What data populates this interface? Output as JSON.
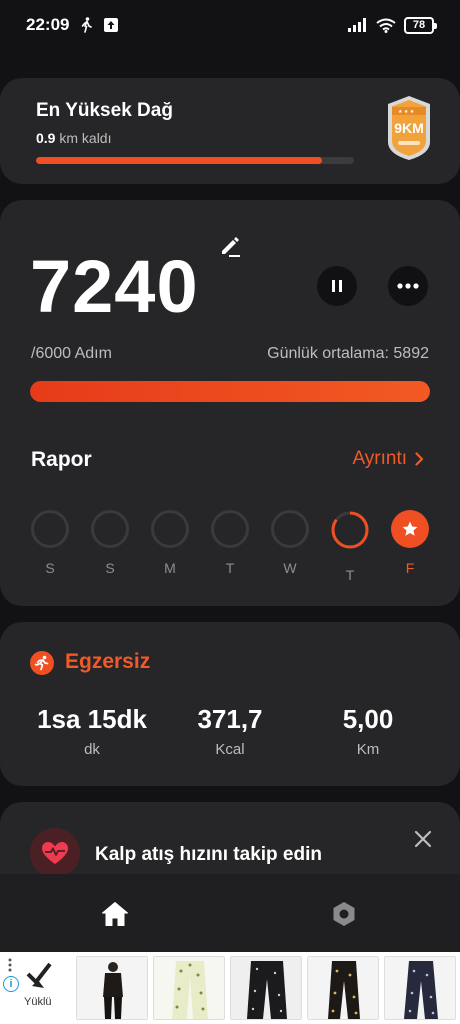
{
  "status_bar": {
    "time": "22:09",
    "battery": "78"
  },
  "challenge": {
    "title": "En Yüksek Dağ",
    "remaining_value": "0.9",
    "remaining_suffix": " km kaldı",
    "progress": 0.9,
    "badge_text": "9KM"
  },
  "steps": {
    "count": "7240",
    "goal": "/6000 Adım",
    "average": "Günlük ortalama: 5892",
    "progress": 1.0
  },
  "report": {
    "title": "Rapor",
    "detail_label": "Ayrıntı",
    "days": [
      {
        "label": "S",
        "state": "empty"
      },
      {
        "label": "S",
        "state": "empty"
      },
      {
        "label": "M",
        "state": "empty"
      },
      {
        "label": "T",
        "state": "empty"
      },
      {
        "label": "W",
        "state": "empty"
      },
      {
        "label": "T",
        "state": "partial",
        "progress": 0.85
      },
      {
        "label": "F",
        "state": "complete"
      }
    ]
  },
  "exercise": {
    "title": "Egzersiz",
    "stats": [
      {
        "value": "1sa 15dk",
        "unit": "dk"
      },
      {
        "value": "371,7",
        "unit": "Kcal"
      },
      {
        "value": "5,00",
        "unit": "Km"
      }
    ]
  },
  "heart_rate": {
    "text": "Kalp atış hızını takip edin"
  },
  "ad": {
    "brand": "Yüklü"
  },
  "colors": {
    "accent": "#f04e23",
    "card": "#262628",
    "background": "#121214"
  },
  "icons": {
    "edit": "pencil-icon",
    "pause": "pause-icon",
    "more": "more-horizontal-icon",
    "exercise": "running-icon",
    "heart": "heart-pulse-icon",
    "close": "close-icon",
    "home": "home-icon",
    "settings": "hexagon-settings-icon"
  }
}
